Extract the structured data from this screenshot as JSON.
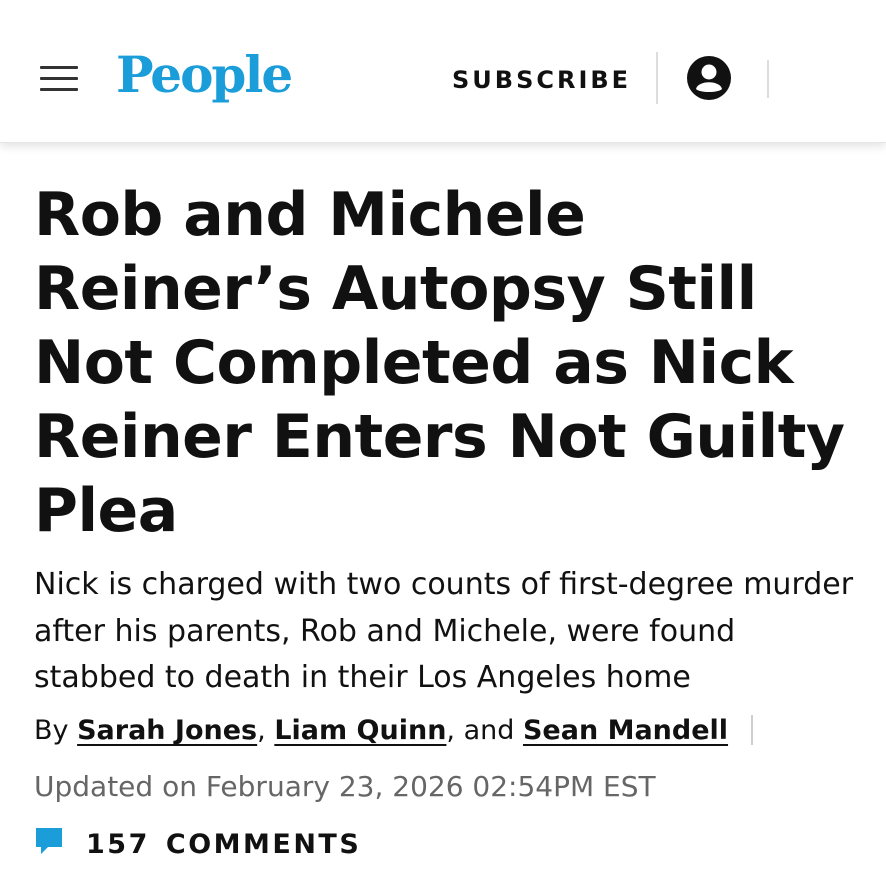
{
  "header": {
    "logo_text": "People",
    "subscribe_label": "SUBSCRIBE",
    "icons": {
      "menu": "hamburger-menu-icon",
      "account": "account-icon"
    }
  },
  "article": {
    "headline": "Rob and Michele Reiner’s Autopsy Still Not Completed as Nick Reiner Enters Not Guilty Plea",
    "dek": "Nick is charged with two counts of first-degree murder after his parents, Rob and Michele, were found stabbed to death in their Los Angeles home",
    "byline": {
      "prefix": "By",
      "authors": [
        "Sarah Jones",
        "Liam Quinn",
        "Sean Mandell"
      ],
      "sep1": ",",
      "sep2": ", and"
    },
    "updated": "Updated on February 23, 2026 02:54PM EST",
    "comments": {
      "count": "157",
      "label": "COMMENTS"
    }
  },
  "colors": {
    "brand": "#1a9dd9",
    "text": "#111111",
    "muted": "#666666",
    "comment_icon": "#1a9dd9"
  }
}
